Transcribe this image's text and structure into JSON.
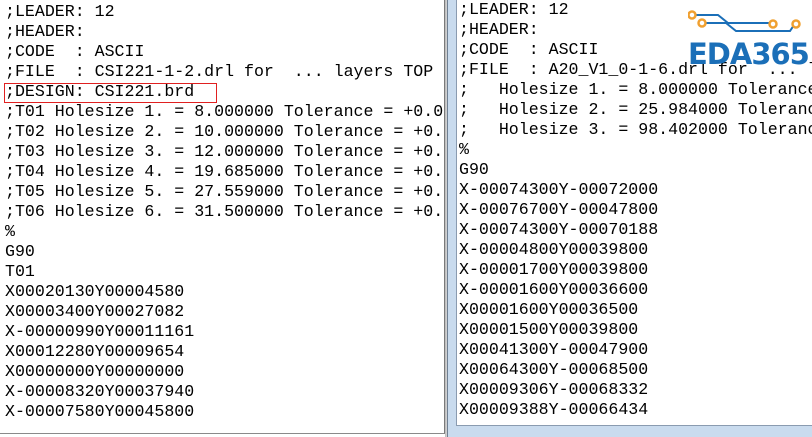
{
  "left_window": {
    "lines": [
      ";LEADER: 12",
      ";HEADER:",
      ";CODE  : ASCII",
      ";FILE  : CSI221-1-2.drl for  ... layers TOP",
      ";DESIGN: CSI221.brd",
      ";T01 Holesize 1. = 8.000000 Tolerance = +0.0",
      ";T02 Holesize 2. = 10.000000 Tolerance = +0.",
      ";T03 Holesize 3. = 12.000000 Tolerance = +0.",
      ";T04 Holesize 4. = 19.685000 Tolerance = +0.",
      ";T05 Holesize 5. = 27.559000 Tolerance = +0.",
      ";T06 Holesize 6. = 31.500000 Tolerance = +0.",
      "%",
      "G90",
      "T01",
      "X00020130Y00004580",
      "X00003400Y00027082",
      "X-00000990Y00011161",
      "X00012280Y00009654",
      "X00000000Y00000000",
      "X-00008320Y00037940",
      "X-00007580Y00045800"
    ]
  },
  "right_window": {
    "lines": [
      ";LEADER: 12",
      ";HEADER:",
      ";CODE  : ASCII",
      ";FILE  : A20_V1_0-1-6.drl for  ... l",
      ";   Holesize 1. = 8.000000 Tolerance",
      ";   Holesize 2. = 25.984000 Toleranc",
      ";   Holesize 3. = 98.402000 Toleranc",
      "%",
      "G90",
      "X-00074300Y-00072000",
      "X-00076700Y-00047800",
      "X-00074300Y-00070188",
      "X-00004800Y00039800",
      "X-00001700Y00039800",
      "X-00001600Y00036600",
      "X00001600Y00036500",
      "X00001500Y00039800",
      "X00041300Y-00047900",
      "X00064300Y-00068500",
      "X00009306Y-00068332",
      "X00009388Y-00066434"
    ]
  },
  "watermark": {
    "text": "EDA365"
  },
  "colors": {
    "highlight": "#e02020",
    "logo_blue": "#1b6fb8",
    "logo_orange": "#f0a030"
  }
}
